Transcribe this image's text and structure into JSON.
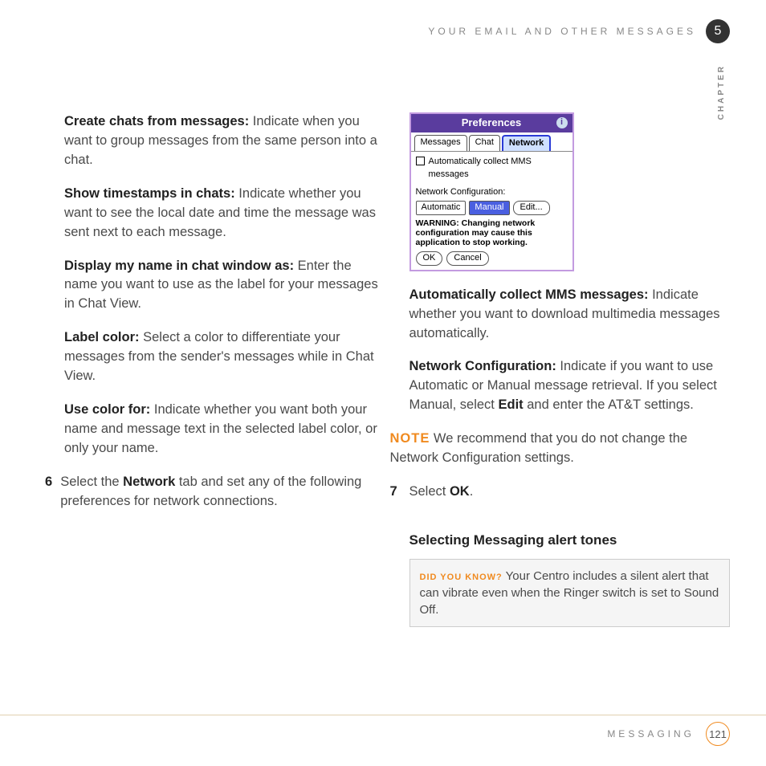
{
  "header": {
    "title": "YOUR EMAIL AND OTHER MESSAGES",
    "chapter_num": "5",
    "chapter_label": "CHAPTER"
  },
  "left": {
    "items": [
      {
        "label": "Create chats from messages:",
        "text": " Indicate when you want to group messages from the same person into a chat."
      },
      {
        "label": "Show timestamps in chats:",
        "text": " Indicate whether you want to see the local date and time the message was sent next to each message."
      },
      {
        "label": "Display my name in chat window as:",
        "text": " Enter the name you want to use as the label for your messages in Chat View."
      },
      {
        "label": "Label color:",
        "text": " Select a color to differentiate your messages from the sender's messages while in Chat View."
      },
      {
        "label": "Use color for:",
        "text": " Indicate whether you want both your name and message text in the selected label color, or only your name."
      }
    ],
    "step6": {
      "num": "6",
      "pre": "Select the ",
      "bold": "Network",
      "post": " tab and set any of the following preferences for network connections."
    }
  },
  "device": {
    "title": "Preferences",
    "tabs": [
      "Messages",
      "Chat",
      "Network"
    ],
    "active_tab": 2,
    "checkbox_label": "Automatically collect MMS messages",
    "config_label": "Network Configuration:",
    "options": [
      "Automatic",
      "Manual"
    ],
    "selected_option": 1,
    "edit_label": "Edit...",
    "warning": "WARNING: Changing network configuration may cause this application to stop working.",
    "ok": "OK",
    "cancel": "Cancel"
  },
  "right": {
    "mms": {
      "label": "Automatically collect MMS messages:",
      "text": " Indicate whether you want to download multimedia messages automatically."
    },
    "net": {
      "label": "Network Configuration:",
      "t1": " Indicate if you want to use Automatic or Manual message retrieval. If you select Manual, select ",
      "bold": "Edit",
      "t2": " and enter the AT&T settings."
    },
    "note": {
      "label": "NOTE",
      "text": " We recommend that you do not change the Network Configuration settings."
    },
    "step7": {
      "num": "7",
      "pre": "Select ",
      "bold": "OK",
      "post": "."
    },
    "subhead": "Selecting Messaging alert tones",
    "tip": {
      "label": "DID YOU KNOW?",
      "text": " Your Centro includes a silent alert that can vibrate even when the Ringer switch is set to Sound Off."
    }
  },
  "footer": {
    "section": "MESSAGING",
    "page": "121"
  }
}
